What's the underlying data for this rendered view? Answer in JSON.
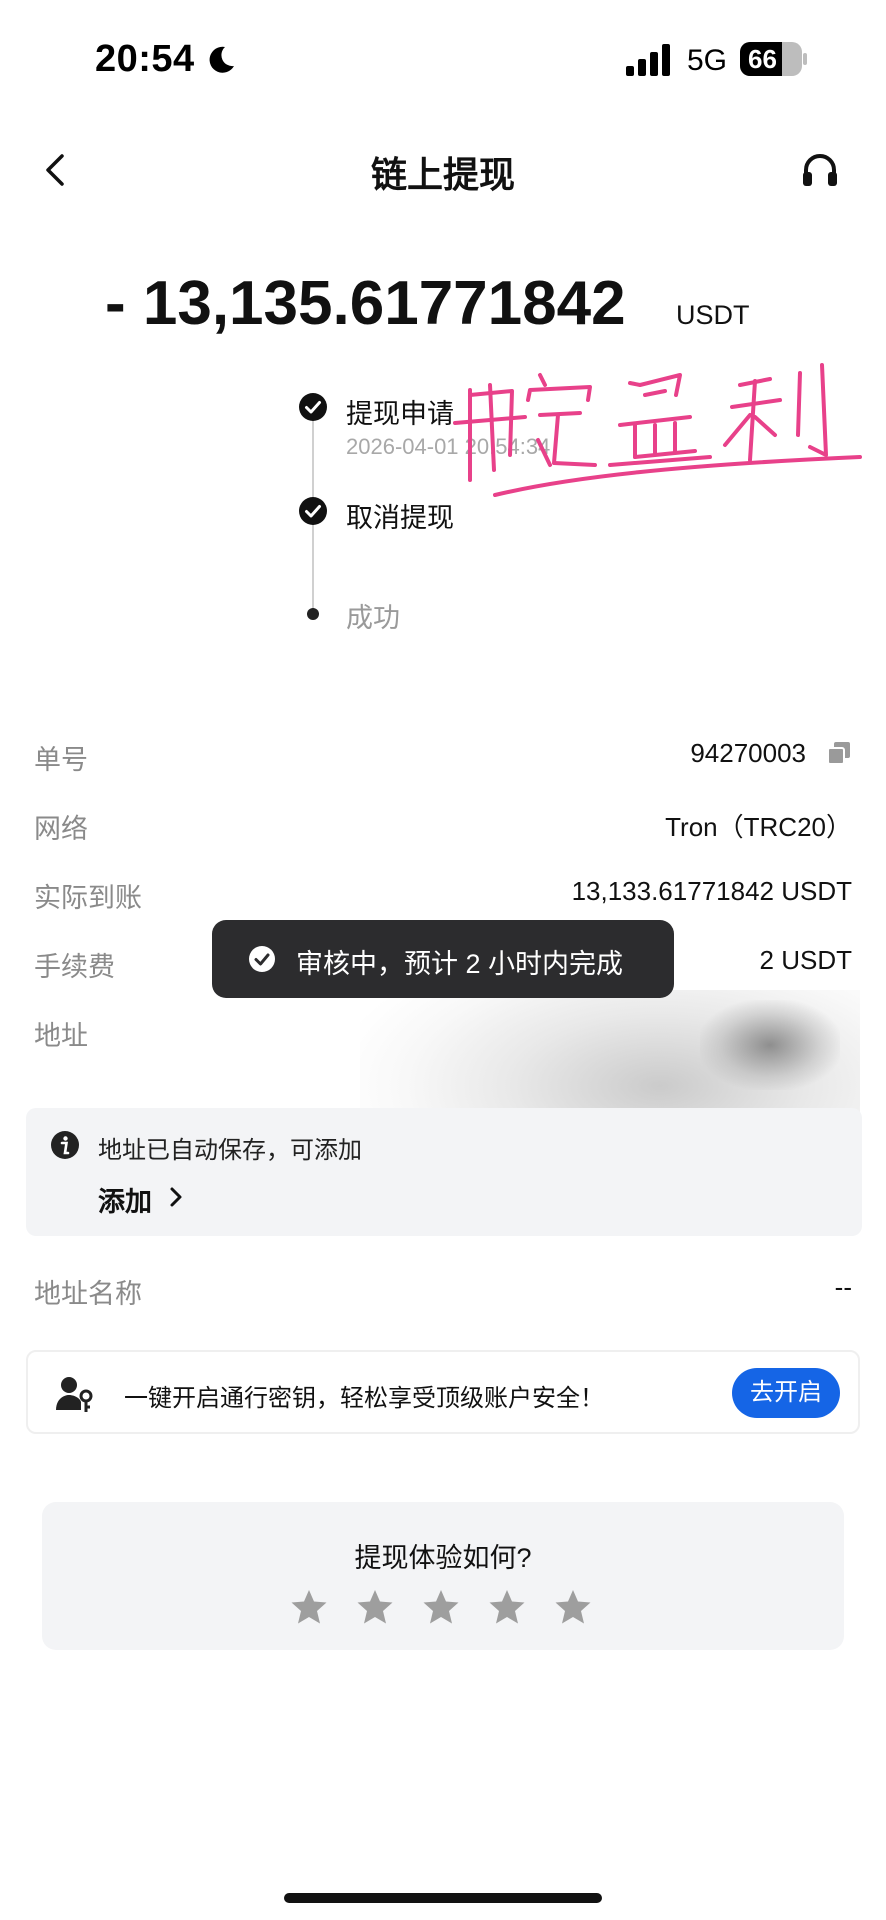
{
  "status_bar": {
    "time": "20:54",
    "network": "5G",
    "battery": "66"
  },
  "nav": {
    "title": "链上提现"
  },
  "withdrawal": {
    "amount": "- 13,135.61771842",
    "unit": "USDT"
  },
  "timeline": [
    {
      "label": "提现申请",
      "time": "2026-04-01 20:54:34",
      "done": true
    },
    {
      "label": "取消提现",
      "done": true
    },
    {
      "label": "成功",
      "done": false
    }
  ],
  "handwriting_note": "币安盈利",
  "details": {
    "order_label": "单号",
    "order_value": "94270003",
    "network_label": "网络",
    "network_value": "Tron（TRC20）",
    "received_label": "实际到账",
    "received_value": "13,133.61771842 USDT",
    "fee_label": "手续费",
    "fee_value": "2 USDT",
    "address_label": "地址",
    "address_name_label": "地址名称",
    "address_name_value": "--"
  },
  "toast": {
    "text": "审核中，预计 2 小时内完成"
  },
  "save_notice": {
    "text": "地址已自动保存，可添加",
    "link": "添加"
  },
  "passkey": {
    "text": "一键开启通行密钥，轻松享受顶级账户安全！",
    "button": "去开启"
  },
  "rating": {
    "title": "提现体验如何?",
    "stars": 5
  },
  "colors": {
    "accent": "#1565e6",
    "toast_bg": "#2c2c2e",
    "muted": "#8a8a8a",
    "handwriting": "#e8418a"
  },
  "icons": [
    "moon-icon",
    "signal-icon",
    "battery-icon",
    "back-icon",
    "headset-icon",
    "check-circle-icon",
    "copy-icon",
    "info-icon",
    "chevron-right-icon",
    "person-key-icon",
    "star-icon"
  ]
}
